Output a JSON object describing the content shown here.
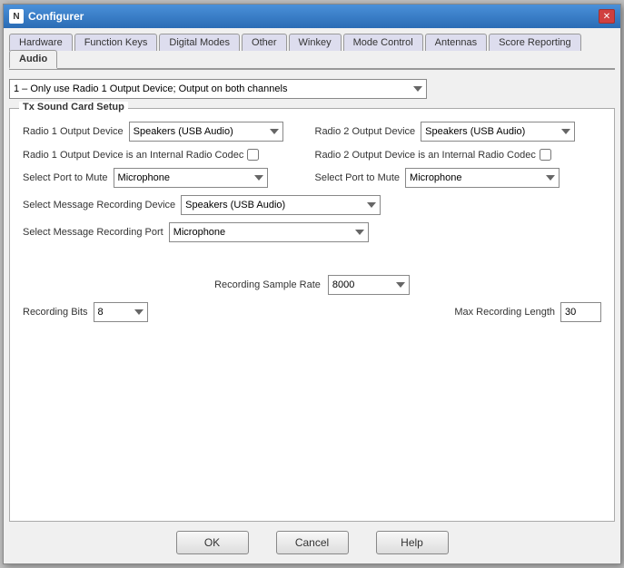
{
  "window": {
    "title": "Configurer",
    "icon": "N",
    "close_label": "✕"
  },
  "tabs": [
    {
      "label": "Hardware",
      "active": false
    },
    {
      "label": "Function Keys",
      "active": false
    },
    {
      "label": "Digital Modes",
      "active": false
    },
    {
      "label": "Other",
      "active": false
    },
    {
      "label": "Winkey",
      "active": false
    },
    {
      "label": "Mode Control",
      "active": false
    },
    {
      "label": "Antennas",
      "active": false
    },
    {
      "label": "Score Reporting",
      "active": false
    },
    {
      "label": "Audio",
      "active": true
    }
  ],
  "top_dropdown": {
    "value": "1 – Only use Radio 1 Output Device; Output on both channels",
    "options": [
      "1 – Only use Radio 1 Output Device; Output on both channels"
    ]
  },
  "group": {
    "label": "Tx Sound Card Setup",
    "radio1_output_label": "Radio 1 Output Device",
    "radio1_output_value": "Speakers (USB Audio)",
    "radio2_output_label": "Radio 2 Output Device",
    "radio2_output_value": "Speakers (USB Audio)",
    "radio1_codec_label": "Radio 1 Output Device is an Internal Radio Codec",
    "radio2_codec_label": "Radio 2 Output Device is an Internal Radio Codec",
    "select_port_mute_label1": "Select Port to Mute",
    "select_port_mute_value1": "Microphone",
    "select_port_mute_label2": "Select Port to Mute",
    "select_port_mute_value2": "Microphone",
    "select_msg_rec_device_label": "Select Message Recording Device",
    "select_msg_rec_device_value": "Speakers (USB Audio)",
    "select_msg_rec_port_label": "Select Message Recording Port",
    "select_msg_rec_port_value": "Microphone",
    "recording_sample_rate_label": "Recording Sample Rate",
    "recording_sample_rate_value": "8000",
    "recording_bits_label": "Recording Bits",
    "recording_bits_value": "8",
    "max_recording_length_label": "Max Recording Length",
    "max_recording_length_value": "30"
  },
  "buttons": {
    "ok": "OK",
    "cancel": "Cancel",
    "help": "Help"
  }
}
